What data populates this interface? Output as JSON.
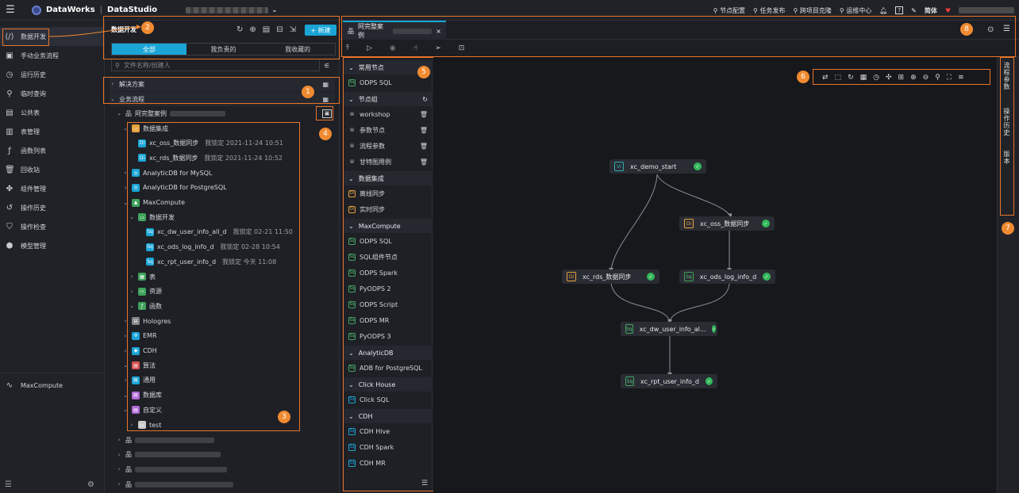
{
  "topbar": {
    "brand": "DataWorks",
    "product": "DataStudio",
    "links": [
      "节点配置",
      "任务发布",
      "跨项目克隆",
      "运维中心"
    ],
    "lang": "简体"
  },
  "leftnav": {
    "items": [
      {
        "label": "数据开发",
        "icon": "code-icon"
      },
      {
        "label": "手动业务流程",
        "icon": "briefcase-icon"
      },
      {
        "label": "运行历史",
        "icon": "clock-icon"
      },
      {
        "label": "临时查询",
        "icon": "search-icon"
      },
      {
        "label": "公共表",
        "icon": "table-icon"
      },
      {
        "label": "表管理",
        "icon": "table-manage-icon"
      },
      {
        "label": "函数列表",
        "icon": "function-icon"
      },
      {
        "label": "回收站",
        "icon": "trash-icon"
      },
      {
        "label": "组件管理",
        "icon": "puzzle-icon"
      },
      {
        "label": "操作历史",
        "icon": "history-icon"
      },
      {
        "label": "操作检查",
        "icon": "shield-icon"
      },
      {
        "label": "模型管理",
        "icon": "cube-icon"
      }
    ],
    "bottom_item": "MaxCompute"
  },
  "tree": {
    "title": "数据开发",
    "new_button": "+ 新建",
    "tabs": [
      "全部",
      "我负责的",
      "我收藏的"
    ],
    "search_placeholder": "文件名称/创建人",
    "sections": [
      "解决方案",
      "业务流程"
    ],
    "workflow_name": "阿完整案例",
    "rows": [
      {
        "label": "数据集成",
        "meta": ""
      },
      {
        "label": "xc_oss_数据同步",
        "meta": "我锁定  2021-11-24 10:51"
      },
      {
        "label": "xc_rds_数据同步",
        "meta": "我锁定  2021-11-24 10:52"
      },
      {
        "label": "AnalyticDB for MySQL",
        "meta": ""
      },
      {
        "label": "AnalyticDB for PostgreSQL",
        "meta": ""
      },
      {
        "label": "MaxCompute",
        "meta": ""
      },
      {
        "label": "数据开发",
        "meta": ""
      },
      {
        "label": "xc_dw_user_info_all_d",
        "meta": "我锁定  02-21 11:50"
      },
      {
        "label": "xc_ods_log_info_d",
        "meta": "我锁定  02-28 10:54"
      },
      {
        "label": "xc_rpt_user_info_d",
        "meta": "我锁定  今天 11:08"
      },
      {
        "label": "表",
        "meta": ""
      },
      {
        "label": "资源",
        "meta": ""
      },
      {
        "label": "函数",
        "meta": ""
      },
      {
        "label": "Hologres",
        "meta": ""
      },
      {
        "label": "EMR",
        "meta": ""
      },
      {
        "label": "CDH",
        "meta": ""
      },
      {
        "label": "算法",
        "meta": ""
      },
      {
        "label": "通用",
        "meta": ""
      },
      {
        "label": "数据库",
        "meta": ""
      },
      {
        "label": "自定义",
        "meta": ""
      },
      {
        "label": "test",
        "meta": ""
      }
    ]
  },
  "filetab": {
    "label": "阿完整案例",
    "close": "×"
  },
  "nodes_panel": {
    "sections": [
      {
        "label": "常用节点",
        "items": [
          "ODPS SQL"
        ]
      },
      {
        "label": "节点组",
        "items": [
          "workshop",
          "参数节点",
          "流程参数",
          "甘特图用例"
        ]
      },
      {
        "label": "数据集成",
        "items": [
          "离线同步",
          "实时同步"
        ]
      },
      {
        "label": "MaxCompute",
        "items": [
          "ODPS SQL",
          "SQL组件节点",
          "ODPS Spark",
          "PyODPS 2",
          "ODPS Script",
          "ODPS MR",
          "PyODPS 3"
        ]
      },
      {
        "label": "AnalyticDB",
        "items": [
          "ADB for PostgreSQL"
        ]
      },
      {
        "label": "Click House",
        "items": [
          "Click SQL"
        ]
      },
      {
        "label": "CDH",
        "items": [
          "CDH Hive",
          "CDH Spark",
          "CDH MR"
        ]
      }
    ]
  },
  "dag": {
    "nodes": [
      {
        "id": "start",
        "label": "xc_demo_start",
        "badge": "Vi"
      },
      {
        "id": "oss",
        "label": "xc_oss_数据同步",
        "badge": "Di"
      },
      {
        "id": "rds",
        "label": "xc_rds_数据同步",
        "badge": "Di"
      },
      {
        "id": "ods",
        "label": "xc_ods_log_info_d",
        "badge": "Sq"
      },
      {
        "id": "dw",
        "label": "xc_dw_user_info_al...",
        "badge": "Sq"
      },
      {
        "id": "rpt",
        "label": "xc_rpt_user_info_d",
        "badge": "Sq"
      }
    ]
  },
  "rightpanel": {
    "items": [
      "流程参数",
      "操作历史",
      "版本"
    ]
  },
  "annotations": [
    "1",
    "2",
    "3",
    "4",
    "5",
    "6",
    "7",
    "8"
  ],
  "colors": {
    "accent": "#1aa5d6",
    "annot": "#f08a30",
    "ok": "#33b85a"
  }
}
